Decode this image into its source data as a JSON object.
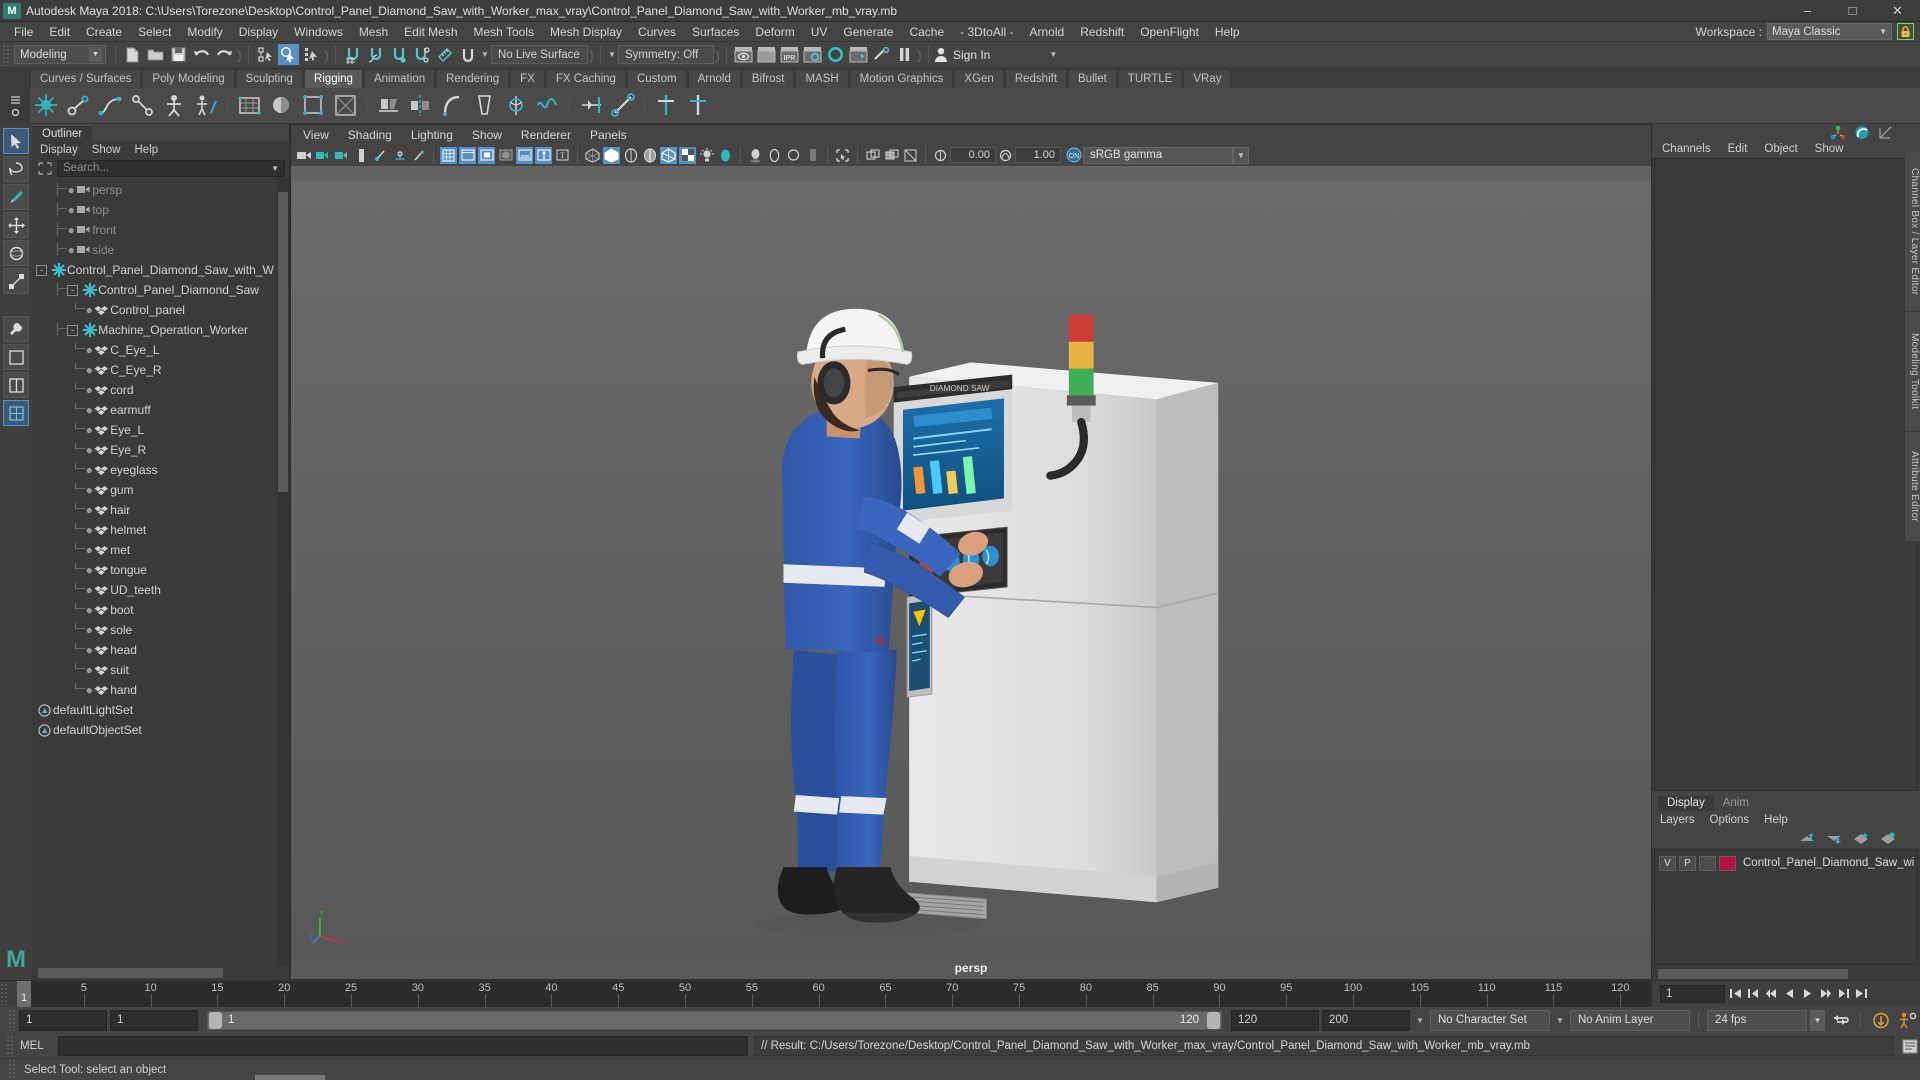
{
  "window": {
    "title": "Autodesk Maya 2018: C:\\Users\\Torezone\\Desktop\\Control_Panel_Diamond_Saw_with_Worker_max_vray\\Control_Panel_Diamond_Saw_with_Worker_mb_vray.mb",
    "app_initial": "M",
    "minimize": "–",
    "maximize": "□",
    "close": "✕"
  },
  "menubar": {
    "items": [
      "File",
      "Edit",
      "Create",
      "Select",
      "Modify",
      "Display",
      "Windows",
      "Mesh",
      "Edit Mesh",
      "Mesh Tools",
      "Mesh Display",
      "Curves",
      "Surfaces",
      "Deform",
      "UV",
      "Generate",
      "Cache",
      "- 3DtoAll -",
      "Arnold",
      "Redshift",
      "OpenFlight",
      "Help"
    ],
    "workspace_label": "Workspace :",
    "workspace_value": "Maya Classic",
    "lock_icon": "lock-icon"
  },
  "statusline": {
    "menuset": "Modeling",
    "live_surface": "No Live Surface",
    "symmetry": "Symmetry: Off",
    "signin": "Sign In",
    "icons": [
      "new-scene-icon",
      "open-scene-icon",
      "save-scene-icon",
      "undo-icon",
      "redo-icon",
      "select-hierarchy-icon",
      "select-object-icon",
      "select-component-icon",
      "snap-grid-icon",
      "snap-curve-icon",
      "snap-point-icon",
      "snap-projected-center-icon",
      "snap-view-plane-icon",
      "make-live-icon",
      "render-current-frame-icon",
      "render-sequence-icon",
      "ipr-render-icon",
      "render-settings-icon",
      "hypershade-icon",
      "render-view-icon",
      "render-globals-icon",
      "pause-render-icon"
    ]
  },
  "shelf": {
    "tabs": [
      "Curves / Surfaces",
      "Poly Modeling",
      "Sculpting",
      "Rigging",
      "Animation",
      "Rendering",
      "FX",
      "FX Caching",
      "Custom",
      "Arnold",
      "Bifrost",
      "MASH",
      "Motion Graphics",
      "XGen",
      "Redshift",
      "Bullet",
      "TURTLE",
      "VRay"
    ],
    "active_tab": "Rigging"
  },
  "outliner": {
    "tab": "Outliner",
    "menus": [
      "Display",
      "Show",
      "Help"
    ],
    "search_placeholder": "Search...",
    "items": [
      {
        "label": "persp",
        "icon": "camera-icon",
        "depth": 1,
        "dim": true,
        "expander": null
      },
      {
        "label": "top",
        "icon": "camera-icon",
        "depth": 1,
        "dim": true,
        "expander": null
      },
      {
        "label": "front",
        "icon": "camera-icon",
        "depth": 1,
        "dim": true,
        "expander": null
      },
      {
        "label": "side",
        "icon": "camera-icon",
        "depth": 1,
        "dim": true,
        "expander": null
      },
      {
        "label": "Control_Panel_Diamond_Saw_with_W",
        "icon": "group-icon",
        "depth": 0,
        "dim": false,
        "expander": "-"
      },
      {
        "label": "Control_Panel_Diamond_Saw",
        "icon": "group-icon",
        "depth": 1,
        "dim": false,
        "expander": "-"
      },
      {
        "label": "Control_panel",
        "icon": "mesh-icon",
        "depth": 2,
        "dim": false,
        "expander": null
      },
      {
        "label": "Machine_Operation_Worker",
        "icon": "group-icon",
        "depth": 1,
        "dim": false,
        "expander": "-"
      },
      {
        "label": "C_Eye_L",
        "icon": "mesh-icon",
        "depth": 2,
        "dim": false,
        "expander": null
      },
      {
        "label": "C_Eye_R",
        "icon": "mesh-icon",
        "depth": 2,
        "dim": false,
        "expander": null
      },
      {
        "label": "cord",
        "icon": "mesh-icon",
        "depth": 2,
        "dim": false,
        "expander": null
      },
      {
        "label": "earmuff",
        "icon": "mesh-icon",
        "depth": 2,
        "dim": false,
        "expander": null
      },
      {
        "label": "Eye_L",
        "icon": "mesh-icon",
        "depth": 2,
        "dim": false,
        "expander": null
      },
      {
        "label": "Eye_R",
        "icon": "mesh-icon",
        "depth": 2,
        "dim": false,
        "expander": null
      },
      {
        "label": "eyeglass",
        "icon": "mesh-icon",
        "depth": 2,
        "dim": false,
        "expander": null
      },
      {
        "label": "gum",
        "icon": "mesh-icon",
        "depth": 2,
        "dim": false,
        "expander": null
      },
      {
        "label": "hair",
        "icon": "mesh-icon",
        "depth": 2,
        "dim": false,
        "expander": null
      },
      {
        "label": "helmet",
        "icon": "mesh-icon",
        "depth": 2,
        "dim": false,
        "expander": null
      },
      {
        "label": "met",
        "icon": "mesh-icon",
        "depth": 2,
        "dim": false,
        "expander": null
      },
      {
        "label": "tongue",
        "icon": "mesh-icon",
        "depth": 2,
        "dim": false,
        "expander": null
      },
      {
        "label": "UD_teeth",
        "icon": "mesh-icon",
        "depth": 2,
        "dim": false,
        "expander": null
      },
      {
        "label": "boot",
        "icon": "mesh-icon",
        "depth": 2,
        "dim": false,
        "expander": null
      },
      {
        "label": "sole",
        "icon": "mesh-icon",
        "depth": 2,
        "dim": false,
        "expander": null
      },
      {
        "label": "head",
        "icon": "mesh-icon",
        "depth": 2,
        "dim": false,
        "expander": null
      },
      {
        "label": "suit",
        "icon": "mesh-icon",
        "depth": 2,
        "dim": false,
        "expander": null
      },
      {
        "label": "hand",
        "icon": "mesh-icon",
        "depth": 2,
        "dim": false,
        "expander": null
      },
      {
        "label": "defaultLightSet",
        "icon": "set-icon",
        "depth": 0,
        "dim": false,
        "expander": null
      },
      {
        "label": "defaultObjectSet",
        "icon": "set-icon",
        "depth": 0,
        "dim": false,
        "expander": null
      }
    ]
  },
  "viewport": {
    "menus": [
      "View",
      "Shading",
      "Lighting",
      "Show",
      "Renderer",
      "Panels"
    ],
    "exposure_value": "0.00",
    "gamma_value": "1.00",
    "color_space": "sRGB gamma",
    "camera_label": "persp",
    "axis": {
      "x": "X",
      "y": "Y",
      "z": "Z"
    }
  },
  "channelbox": {
    "menus": [
      "Channels",
      "Edit",
      "Object",
      "Show"
    ],
    "side_tabs": [
      "Channel Box / Layer Editor",
      "Modeling Toolkit",
      "Attribute Editor"
    ]
  },
  "layer_editor": {
    "tabs": [
      "Display",
      "Anim"
    ],
    "active_tab": "Display",
    "menus": [
      "Layers",
      "Options",
      "Help"
    ],
    "columns": [
      "V",
      "P"
    ],
    "layers": [
      {
        "v": "",
        "p": "P",
        "color": "#b5123e",
        "name": "Control_Panel_Diamond_Saw_wi"
      }
    ]
  },
  "timeline": {
    "ticks": [
      5,
      10,
      15,
      20,
      25,
      30,
      35,
      40,
      45,
      50,
      55,
      60,
      65,
      70,
      75,
      80,
      85,
      90,
      95,
      100,
      105,
      110,
      115,
      120
    ],
    "current_frame": "1",
    "frame_field": "1",
    "playback_buttons": [
      "go-to-start-icon",
      "step-back-frame-icon",
      "step-back-key-icon",
      "play-backwards-icon",
      "play-forwards-icon",
      "step-forward-key-icon",
      "step-forward-frame-icon",
      "go-to-end-icon"
    ]
  },
  "range": {
    "start_field": "1",
    "end_field": "1",
    "range_start": "1",
    "range_end": "120",
    "anim_end": "120",
    "playback_end": "200",
    "character_set": "No Character Set",
    "anim_layer": "No Anim Layer",
    "fps": "24 fps",
    "loop_icon": "loop-icon",
    "key_icon": "auto-keyframe-icon",
    "prefs_icon": "animation-preferences-icon"
  },
  "commandline": {
    "mel_label": "MEL",
    "input_value": "",
    "result": "// Result: C:/Users/Torezone/Desktop/Control_Panel_Diamond_Saw_with_Worker_max_vray/Control_Panel_Diamond_Saw_with_Worker_mb_vray.mb"
  },
  "helpline": {
    "text": "Select Tool: select an object"
  },
  "colors": {
    "accent_blue": "#5791c4",
    "teal": "#3aa89a",
    "layer_red": "#b5123e",
    "lock_green": "#7bd84b"
  }
}
